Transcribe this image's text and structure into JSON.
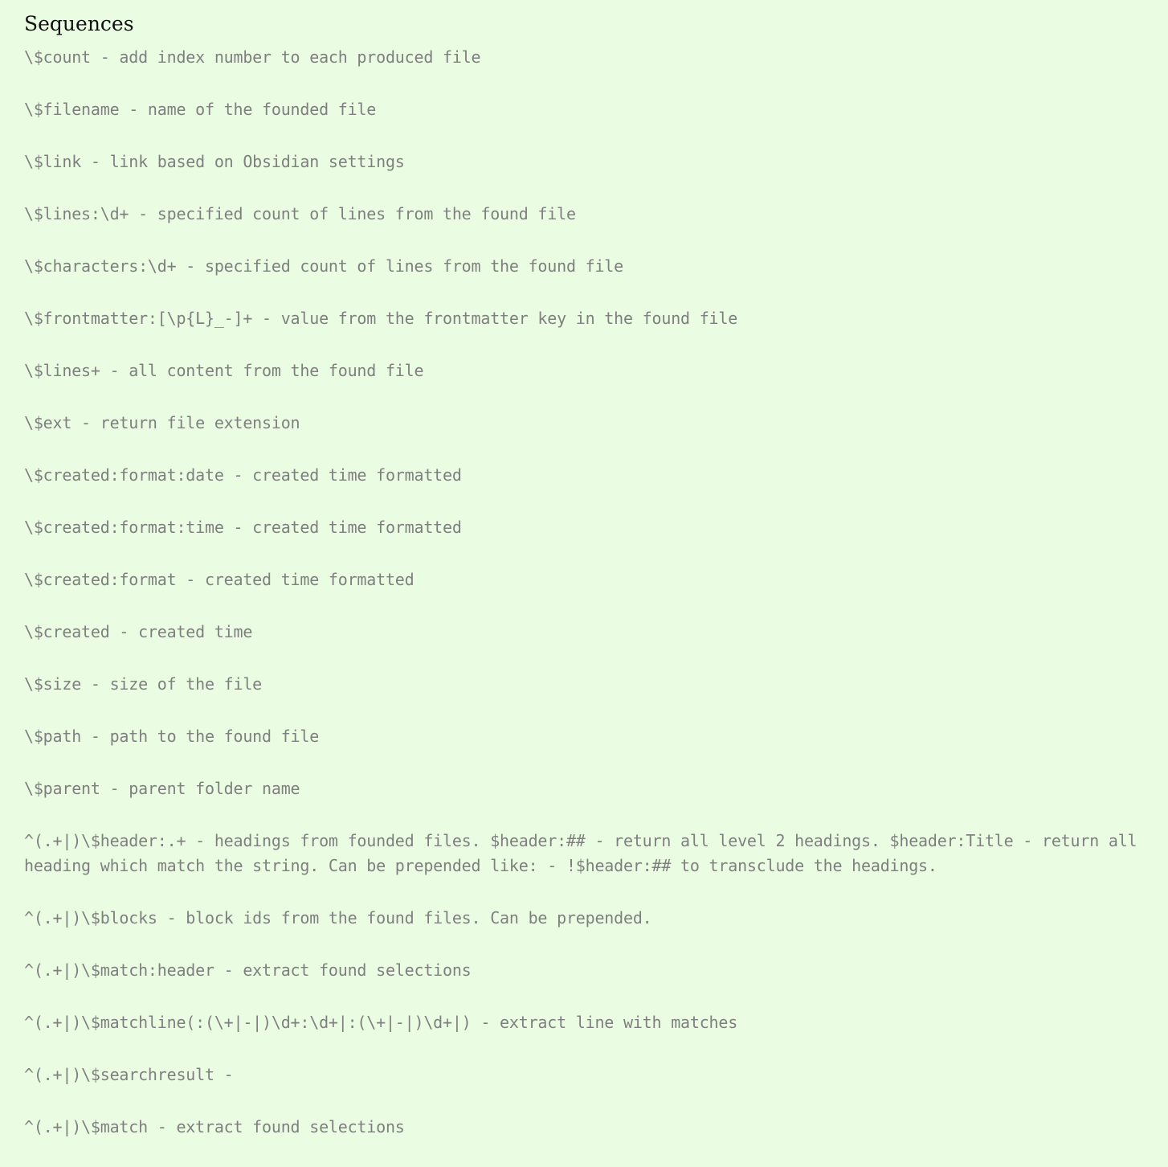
{
  "document": {
    "title": "Sequences",
    "items": [
      "\\$count - add index number to each produced file",
      "\\$filename - name of the founded file",
      "\\$link - link based on Obsidian settings",
      "\\$lines:\\d+ - specified count of lines from the found file",
      "\\$characters:\\d+ - specified count of lines from the found file",
      "\\$frontmatter:[\\p{L}_-]+ - value from the frontmatter key in the found file",
      "\\$lines+ - all content from the found file",
      "\\$ext - return file extension",
      "\\$created:format:date - created time formatted",
      "\\$created:format:time - created time formatted",
      "\\$created:format - created time formatted",
      "\\$created - created time",
      "\\$size - size of the file",
      "\\$path - path to the found file",
      "\\$parent - parent folder name",
      "^(.+|)\\$header:.+ - headings from founded files. $header:## - return all level 2 headings. $header:Title - return all heading which match the string. Can be prepended like: - !$header:## to transclude the headings.",
      "^(.+|)\\$blocks - block ids from the found files. Can be prepended.",
      "^(.+|)\\$match:header - extract found selections",
      "^(.+|)\\$matchline(:(\\+|-|)\\d+:\\d+|:(\\+|-|)\\d+|) - extract line with matches",
      "^(.+|)\\$searchresult -",
      "^(.+|)\\$match - extract found selections"
    ]
  }
}
